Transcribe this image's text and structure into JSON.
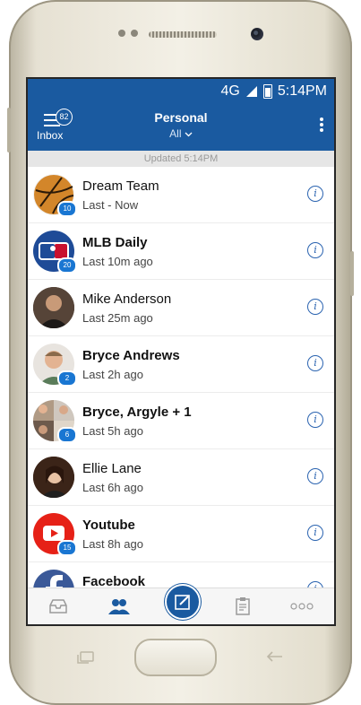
{
  "status_bar": {
    "network": "4G",
    "time": "5:14PM"
  },
  "header": {
    "inbox_label": "Inbox",
    "inbox_count": "82",
    "title": "Personal",
    "filter": "All"
  },
  "updated_text": "Updated 5:14PM",
  "conversations": [
    {
      "name": "Dream Team",
      "sub": "Last - Now",
      "badge": "10"
    },
    {
      "name": "MLB Daily",
      "sub": "Last 10m ago",
      "badge": "20"
    },
    {
      "name": "Mike Anderson",
      "sub": "Last 25m ago",
      "badge": ""
    },
    {
      "name": "Bryce Andrews",
      "sub": "Last 2h ago",
      "badge": "2"
    },
    {
      "name": "Bryce, Argyle + 1",
      "sub": "Last 5h ago",
      "badge": "6"
    },
    {
      "name": "Ellie Lane",
      "sub": "Last 6h ago",
      "badge": ""
    },
    {
      "name": "Youtube",
      "sub": "Last 8h ago",
      "badge": "15"
    },
    {
      "name": "Facebook",
      "sub": "",
      "badge": ""
    }
  ],
  "tabs": [
    "inbox-icon",
    "people-icon",
    "compose-icon",
    "clipboard-icon",
    "more-icon"
  ],
  "colors": {
    "header_blue": "#1a5aa0",
    "badge_blue": "#1976d2"
  }
}
